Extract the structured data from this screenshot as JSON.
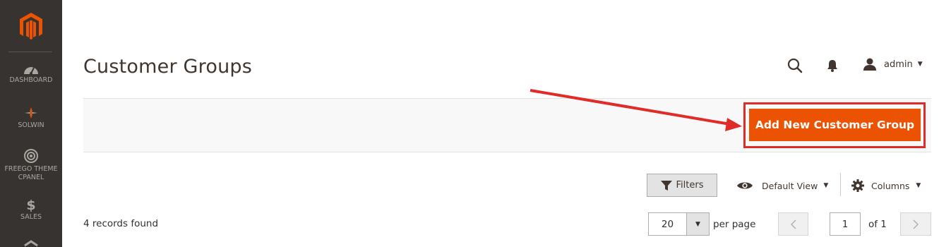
{
  "sidebar": {
    "logo_icon": "magento-logo-icon",
    "items": [
      {
        "label": "DASHBOARD",
        "icon": "dashboard-icon"
      },
      {
        "label": "SOLWIN",
        "icon": "solwin-icon"
      },
      {
        "label_line1": "FREEGO THEME",
        "label_line2": "CPANEL",
        "icon": "target-icon"
      },
      {
        "label": "SALES",
        "icon": "dollar-icon"
      }
    ]
  },
  "header": {
    "title": "Customer Groups",
    "user_name": "admin",
    "search_icon": "search-icon",
    "bell_icon": "bell-icon"
  },
  "actions": {
    "add_button_label": "Add New Customer Group",
    "accent_color": "#eb5202",
    "highlight_color": "#e02b27"
  },
  "toolbar": {
    "filters_label": "Filters",
    "view_label": "Default View",
    "columns_label": "Columns"
  },
  "grid": {
    "records_text": "4 records found",
    "per_page_value": "20",
    "per_page_label": "per page",
    "current_page": "1",
    "of_pages_text": "of 1"
  }
}
